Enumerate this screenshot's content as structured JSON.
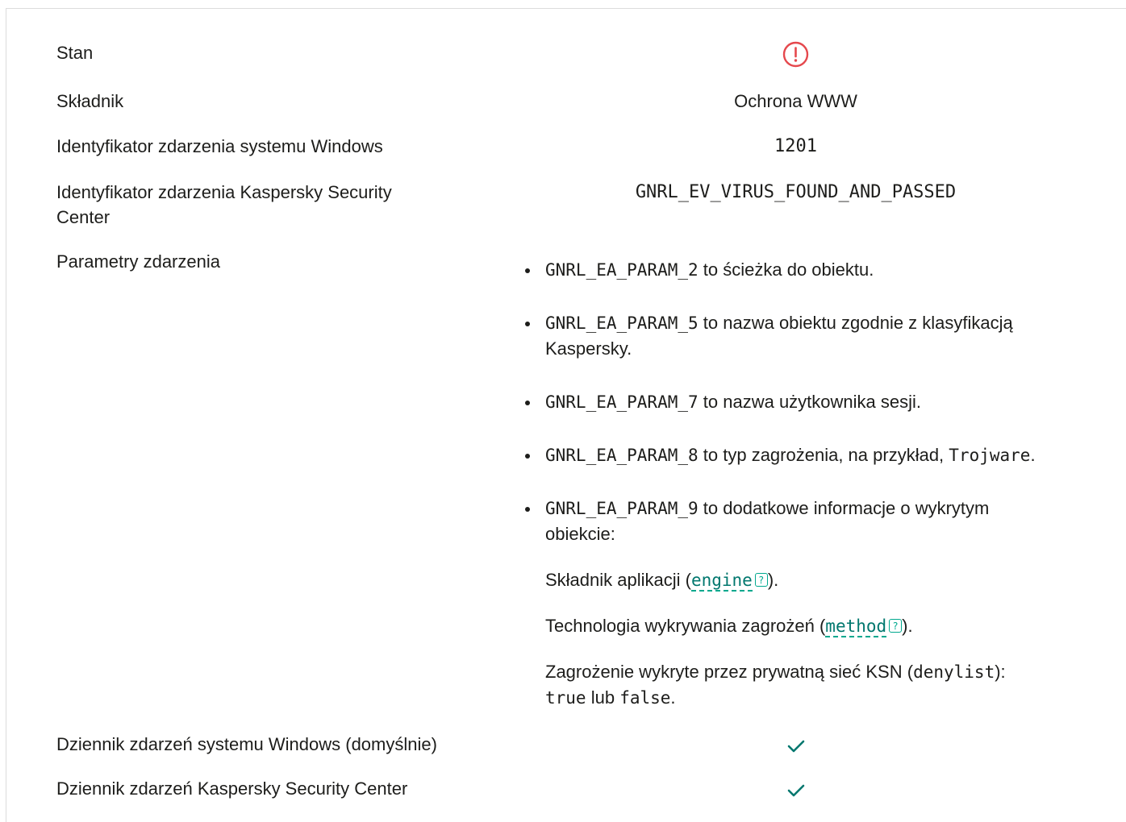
{
  "rows": {
    "status_label": "Stan",
    "component_label": "Składnik",
    "component_value": "Ochrona WWW",
    "win_event_id_label": "Identyfikator zdarzenia systemu Windows",
    "win_event_id_value": "1201",
    "ksc_event_id_label_line1": "Identyfikator zdarzenia Kaspersky Security",
    "ksc_event_id_label_line2": "Center",
    "ksc_event_id_value": "GNRL_EV_VIRUS_FOUND_AND_PASSED",
    "params_label": "Parametry zdarzenia",
    "win_log_label": "Dziennik zdarzeń systemu Windows (domyślnie)",
    "ksc_log_label": "Dziennik zdarzeń Kaspersky Security Center"
  },
  "status_icon": "error-circle-icon",
  "colors": {
    "error": "#e5484d",
    "accent": "#00a88e",
    "link": "#00776e"
  },
  "params": [
    {
      "code": "GNRL_EA_PARAM_2",
      "text": "to ścieżka do obiektu."
    },
    {
      "code": "GNRL_EA_PARAM_5",
      "text": "to nazwa obiektu zgodnie z klasyfikacją",
      "text2": "Kaspersky."
    },
    {
      "code": "GNRL_EA_PARAM_7",
      "text": "to nazwa użytkownika sesji."
    },
    {
      "code": "GNRL_EA_PARAM_8",
      "text": "to typ zagrożenia, na przykład,",
      "example": "Trojware",
      "after": "."
    },
    {
      "code": "GNRL_EA_PARAM_9",
      "text": "to dodatkowe informacje o wykrytym",
      "text2": "obiekcie:"
    }
  ],
  "details": {
    "engine_prefix": "Składnik aplikacji (",
    "engine_link": "engine",
    "engine_suffix": ").",
    "method_prefix": "Technologia wykrywania zagrożeń (",
    "method_link": "method",
    "method_suffix": ").",
    "ksn_text": "Zagrożenie wykryte przez prywatną sieć KSN (",
    "ksn_code": "denylist",
    "ksn_close": "):",
    "true_code": "true",
    "or_text": "lub",
    "false_code": "false",
    "end_dot": "."
  },
  "help_glyph": "?",
  "win_log_enabled": true,
  "ksc_log_enabled": true
}
